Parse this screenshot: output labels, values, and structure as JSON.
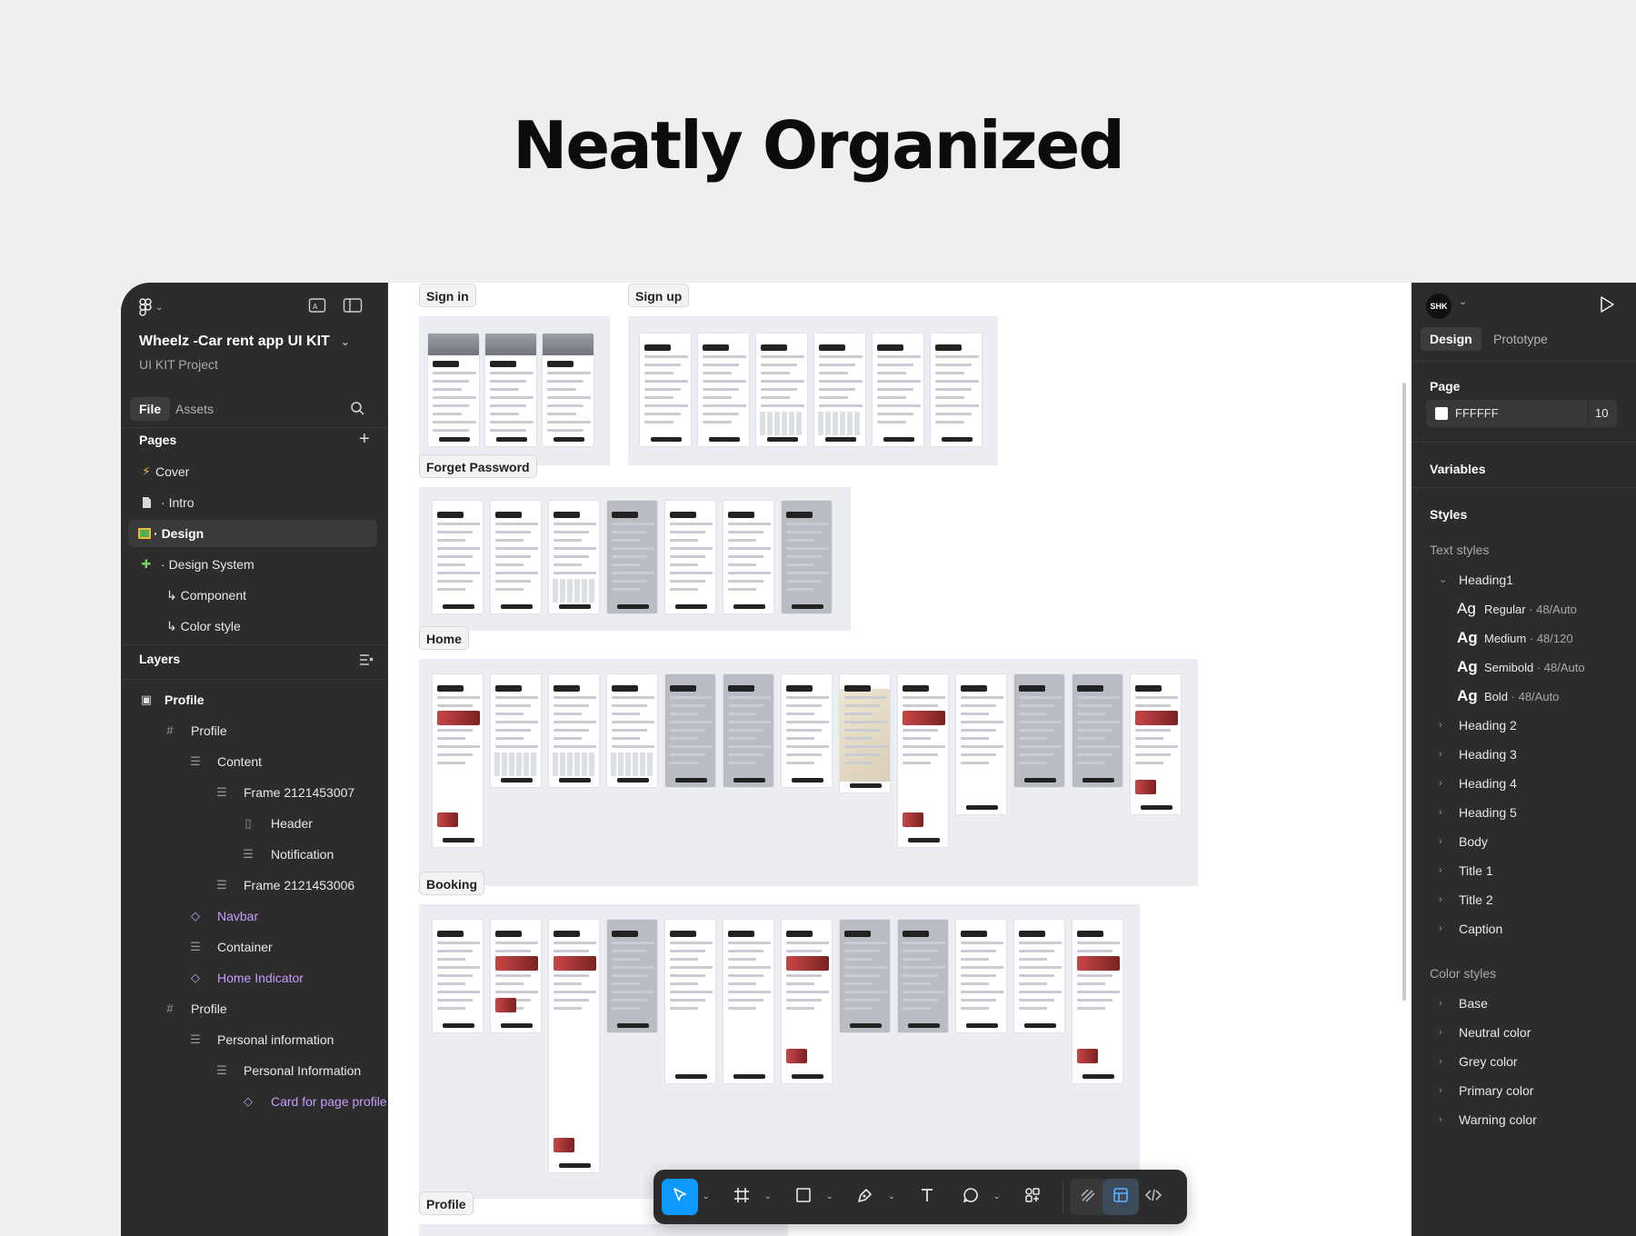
{
  "headline": "Neatly Organized",
  "sidebar": {
    "project_title": "Wheelz -Car rent app UI KIT",
    "project_subtitle": "UI KIT Project",
    "tabs": [
      "File",
      "Assets"
    ],
    "pages_title": "Pages",
    "pages": [
      {
        "icon": "⚡",
        "label": "Cover"
      },
      {
        "icon": "📄",
        "label": "Intro"
      },
      {
        "icon": "🖼",
        "label": "Design"
      },
      {
        "icon": "🧩",
        "label": "Design System"
      },
      {
        "icon": "",
        "label": "↳ Component"
      },
      {
        "icon": "",
        "label": "↳ Color style"
      }
    ],
    "layers_title": "Layers",
    "layers": [
      {
        "icon": "▣",
        "label": "Profile"
      },
      {
        "icon": "#",
        "label": "Profile"
      },
      {
        "icon": "☰",
        "label": "Content"
      },
      {
        "icon": "☰",
        "label": "Frame 2121453007"
      },
      {
        "icon": "▯",
        "label": "Header"
      },
      {
        "icon": "☰",
        "label": "Notification"
      },
      {
        "icon": "☰",
        "label": "Frame 2121453006"
      },
      {
        "icon": "◇",
        "label": "Navbar"
      },
      {
        "icon": "☰",
        "label": "Container"
      },
      {
        "icon": "◇",
        "label": "Home Indicator"
      },
      {
        "icon": "#",
        "label": "Profile"
      },
      {
        "icon": "☰",
        "label": "Personal information"
      },
      {
        "icon": "☰",
        "label": "Personal Information"
      },
      {
        "icon": "◇",
        "label": "Card for page profile"
      }
    ]
  },
  "canvas": {
    "sections": [
      "Sign in",
      "Sign up",
      "Forget Password",
      "Home",
      "Booking",
      "Profile"
    ]
  },
  "right_panel": {
    "avatar": "SHK",
    "tabs": [
      "Design",
      "Prototype"
    ],
    "page_title": "Page",
    "page_color": "FFFFFF",
    "page_opacity": "10",
    "variables_title": "Variables",
    "styles_title": "Styles",
    "text_styles_title": "Text styles",
    "heading1": "Heading1",
    "heading1_variants": [
      {
        "name": "Regular",
        "spec": "· 48/Auto"
      },
      {
        "name": "Medium",
        "spec": "· 48/120"
      },
      {
        "name": "Semibold",
        "spec": "· 48/Auto"
      },
      {
        "name": "Bold",
        "spec": "· 48/Auto"
      }
    ],
    "text_styles": [
      "Heading 2",
      "Heading 3",
      "Heading 4",
      "Heading 5",
      "Body",
      "Title 1",
      "Title 2",
      "Caption"
    ],
    "color_styles_title": "Color styles",
    "color_styles": [
      "Base",
      "Neutral color",
      "Grey color",
      "Primary color",
      "Warning color"
    ],
    "ag": "Ag"
  },
  "colors": {
    "accent": "#0d99ff",
    "component_purple": "#c89bff",
    "panel_bg": "#2c2c2c"
  }
}
